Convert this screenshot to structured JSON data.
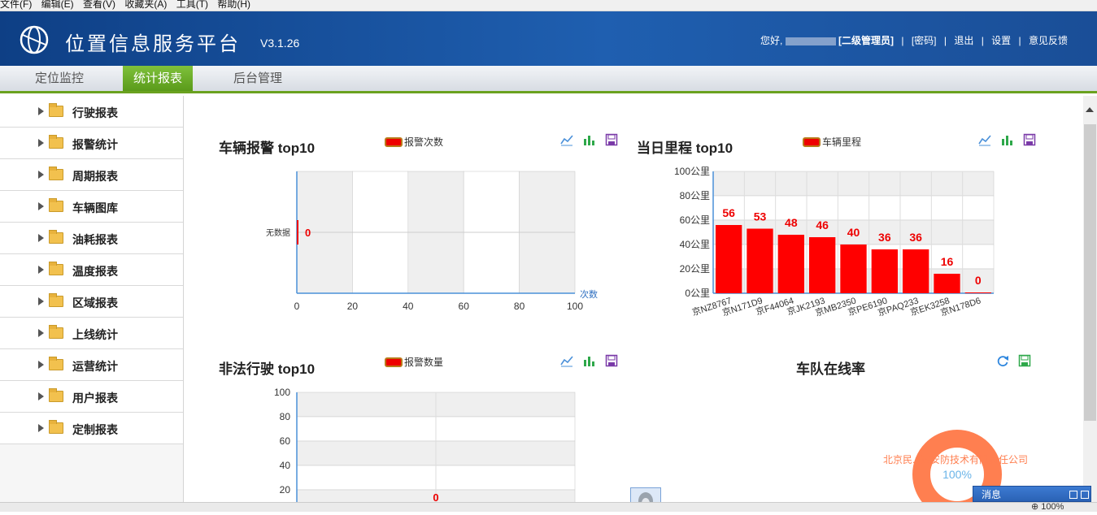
{
  "menubar": [
    "文件(F)",
    "编辑(E)",
    "查看(V)",
    "收藏夹(A)",
    "工具(T)",
    "帮助(H)"
  ],
  "header": {
    "title": "位置信息服务平台",
    "version": "V3.1.26",
    "greeting": "您好,",
    "role": "[二级管理员]",
    "links": [
      "[密码]",
      "退出",
      "设置",
      "意见反馈"
    ]
  },
  "nav": {
    "tabs": [
      "定位监控",
      "统计报表",
      "后台管理"
    ],
    "active": "统计报表"
  },
  "sidebar": {
    "items": [
      "行驶报表",
      "报警统计",
      "周期报表",
      "车辆图库",
      "油耗报表",
      "温度报表",
      "区域报表",
      "上线统计",
      "运营统计",
      "用户报表",
      "定制报表"
    ]
  },
  "panels": {
    "alarm": {
      "title": "车辆报警  top10",
      "legend": "报警次数"
    },
    "mileage": {
      "title": "当日里程  top10",
      "legend": "车辆里程"
    },
    "illegal": {
      "title": "非法行驶  top10",
      "legend": "报警数量"
    },
    "online": {
      "title": "车队在线率"
    }
  },
  "chart_data": [
    {
      "type": "bar",
      "orientation": "horizontal",
      "title": "车辆报警  top10",
      "categories": [
        "无数据"
      ],
      "series": [
        {
          "name": "报警次数",
          "values": [
            0
          ]
        }
      ],
      "xlabel": "次数",
      "xlim": [
        0,
        100
      ],
      "xticks": [
        0,
        20,
        40,
        60,
        80,
        100
      ],
      "grid": true,
      "legend": "top"
    },
    {
      "type": "bar",
      "title": "当日里程  top10",
      "categories": [
        "京NZ8767",
        "京N171D9",
        "京F44064",
        "京JK2193",
        "京MB2350",
        "京PE6190",
        "京PAQ233",
        "京EK3258",
        "京N178D6"
      ],
      "series": [
        {
          "name": "车辆里程",
          "values": [
            56,
            53,
            48,
            46,
            40,
            36,
            36,
            16,
            0
          ]
        }
      ],
      "ylim": [
        0,
        100
      ],
      "yticks": [
        "0公里",
        "20公里",
        "40公里",
        "60公里",
        "80公里",
        "100公里"
      ],
      "grid": true,
      "legend": "top",
      "color": "#ff0000"
    },
    {
      "type": "bar",
      "title": "非法行驶  top10",
      "series": [
        {
          "name": "报警数量",
          "values": [
            0
          ]
        }
      ],
      "ylim": [
        0,
        100
      ],
      "yticks": [
        20,
        40,
        60,
        80,
        100
      ],
      "grid": true,
      "legend": "top"
    },
    {
      "type": "pie",
      "title": "车队在线率",
      "categories": [
        "北京民...达安防技术有限责任公司"
      ],
      "values": [
        100
      ],
      "label": "100%",
      "color": "#ff7f50"
    }
  ],
  "messages": {
    "title": "消息"
  },
  "status": {
    "zoom": "100%"
  },
  "colors": {
    "accent": "#6aa21f",
    "header": "#1a4e97",
    "bar": "#ff0000",
    "ring": "#ff7f50"
  }
}
